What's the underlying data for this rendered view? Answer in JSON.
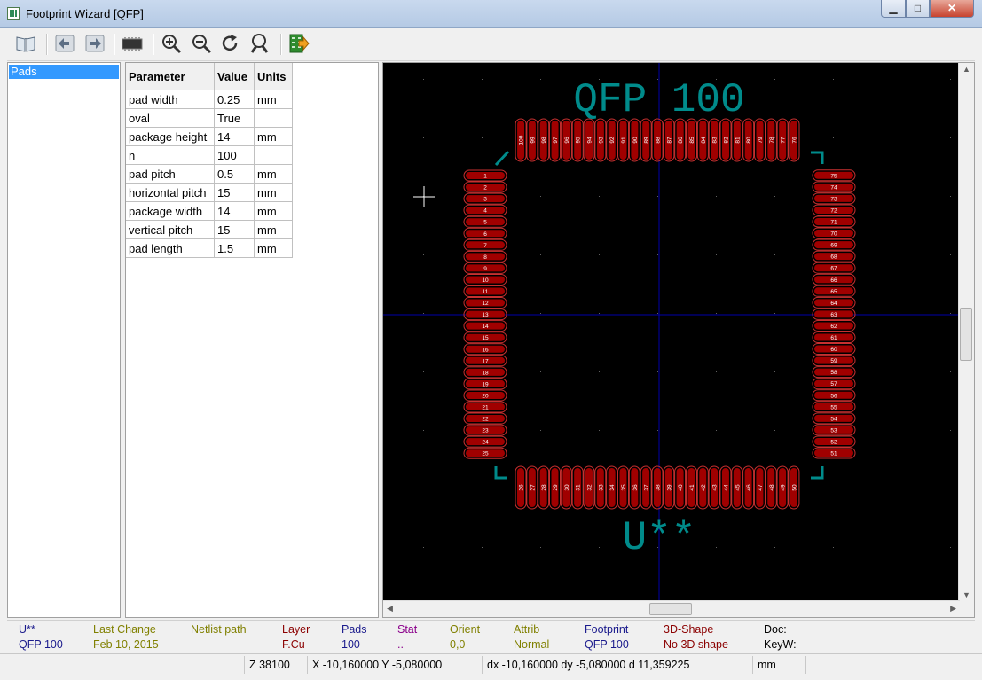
{
  "window": {
    "title": "Footprint Wizard [QFP]",
    "minimize_glyph": "▁",
    "maximize_glyph": "□",
    "close_glyph": "✕"
  },
  "toolbar": {
    "buttons": [
      {
        "icon": "book-icon"
      },
      {
        "icon": "previous-arrow-icon"
      },
      {
        "icon": "next-arrow-icon"
      },
      {
        "icon": "footprint-chip-icon"
      },
      {
        "icon": "zoom-in-icon"
      },
      {
        "icon": "zoom-out-icon"
      },
      {
        "icon": "redraw-icon"
      },
      {
        "icon": "zoom-fit-icon"
      },
      {
        "icon": "export-footprint-icon"
      }
    ]
  },
  "pages": {
    "items": [
      {
        "label": "Pads"
      }
    ]
  },
  "parameters": {
    "headers": [
      "Parameter",
      "Value",
      "Units"
    ],
    "rows": [
      {
        "parameter": "pad width",
        "value": "0.25",
        "units": "mm"
      },
      {
        "parameter": "oval",
        "value": "True",
        "units": ""
      },
      {
        "parameter": "package height",
        "value": "14",
        "units": "mm"
      },
      {
        "parameter": "n",
        "value": "100",
        "units": ""
      },
      {
        "parameter": "pad pitch",
        "value": "0.5",
        "units": "mm"
      },
      {
        "parameter": "horizontal pitch",
        "value": "15",
        "units": "mm"
      },
      {
        "parameter": "package width",
        "value": "14",
        "units": "mm"
      },
      {
        "parameter": "vertical pitch",
        "value": "15",
        "units": "mm"
      },
      {
        "parameter": "pad length",
        "value": "1.5",
        "units": "mm"
      }
    ]
  },
  "footprint": {
    "value_text": "QFP 100",
    "reference_text": "U**",
    "pad_count": 100,
    "pads_per_side": 25,
    "colors": {
      "background": "#000000",
      "pad_fill": "#a00000",
      "pad_outline": "#c83030",
      "silk": "#008b8b",
      "grid_axis": "#0000aa",
      "pad_number": "#ffffff"
    }
  },
  "message_panel": {
    "columns": [
      {
        "label": "U**",
        "value": "QFP 100",
        "color": "#1a1a8c"
      },
      {
        "label": "Last Change",
        "value": "Feb 10, 2015",
        "color": "#808000"
      },
      {
        "label": "Netlist path",
        "value": "",
        "color": "#808000"
      },
      {
        "label": "Layer",
        "value": "F.Cu",
        "color": "#8b0000"
      },
      {
        "label": "Pads",
        "value": "100",
        "color": "#1a1a8c"
      },
      {
        "label": "Stat",
        "value": "..",
        "color": "#8b008b"
      },
      {
        "label": "Orient",
        "value": "0,0",
        "color": "#808000"
      },
      {
        "label": "Attrib",
        "value": "Normal",
        "color": "#808000"
      },
      {
        "label": "Footprint",
        "value": "QFP 100",
        "color": "#1a1a8c"
      },
      {
        "label": "3D-Shape",
        "value": "No 3D shape",
        "color": "#8b0000"
      },
      {
        "label": "Doc:",
        "value": "KeyW:",
        "color": "#000000"
      }
    ]
  },
  "status_bar": {
    "zoom": "Z 38100",
    "xy": "X -10,160000  Y -5,080000",
    "delta": "dx -10,160000  dy -5,080000  d 11,359225",
    "units": "mm"
  }
}
